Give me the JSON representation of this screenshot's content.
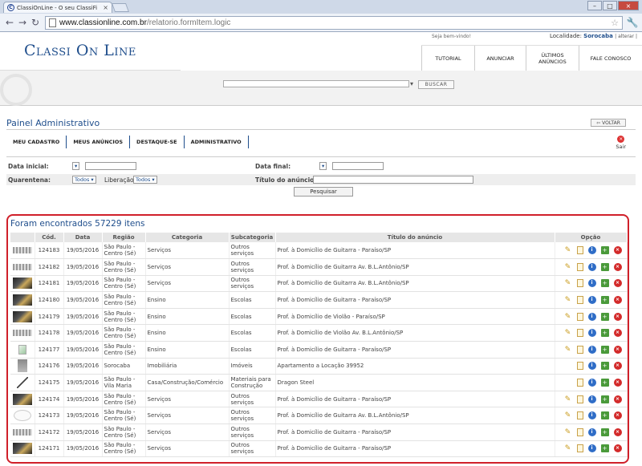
{
  "browser": {
    "tab_title": "ClassiOnLine - O seu ClassiFi",
    "url_host": "www.classionline.com.br",
    "url_path": "/relatorio.formItem.logic",
    "favicon_letter": "C",
    "icons": {
      "back": "back-arrow-icon",
      "forward": "forward-arrow-icon",
      "reload": "reload-icon",
      "star": "star-icon",
      "wrench": "wrench-icon"
    }
  },
  "header": {
    "logo": "Classi On Line",
    "welcome": "Seja bem-vindo!",
    "locality_label": "Localidade:",
    "locality_city": "Sorocaba",
    "locality_change": "| alterar |",
    "nav": [
      "TUTORIAL",
      "ANUNCIAR",
      "ÚLTIMOS ANÚNCIOS",
      "FALE CONOSCO"
    ],
    "search_button": "BUSCAR"
  },
  "panel": {
    "title": "Painel Administrativo",
    "back_button": "VOLTAR",
    "tabs": [
      "MEU CADASTRO",
      "MEUS ANÚNCIOS",
      "DESTAQUE-SE",
      "ADMINISTRATIVO"
    ],
    "logout": "Sair"
  },
  "filters": {
    "data_inicial_label": "Data inicial:",
    "data_final_label": "Data final:",
    "quarentena_label": "Quarentena:",
    "quarentena_value": "Todos",
    "liberacao_label": "Liberação",
    "liberacao_value": "Todos",
    "titulo_label": "Título do anúncio:",
    "date_dropdown": "▾",
    "search_button": "Pesquisar"
  },
  "results": {
    "title": "Foram encontrados 57229 itens",
    "columns": [
      "",
      "Cód.",
      "Data",
      "Região",
      "Categoria",
      "Subcategoria",
      "Título do anúncio",
      "Opção"
    ],
    "rows": [
      {
        "thumb": "light",
        "cod": "124183",
        "data": "19/05/2016",
        "regiao": "São Paulo - Centro (Sé)",
        "categoria": "Serviços",
        "sub": "Outros serviços",
        "titulo": "Prof. à Domicílio de Guitarra - Paraíso/SP",
        "edit": true
      },
      {
        "thumb": "light",
        "cod": "124182",
        "data": "19/05/2016",
        "regiao": "São Paulo - Centro (Sé)",
        "categoria": "Serviços",
        "sub": "Outros serviços",
        "titulo": "Prof. à Domicílio de Guitarra Av. B.L.Antônio/SP",
        "edit": true
      },
      {
        "thumb": "dark",
        "cod": "124181",
        "data": "19/05/2016",
        "regiao": "São Paulo - Centro (Sé)",
        "categoria": "Serviços",
        "sub": "Outros serviços",
        "titulo": "Prof. à Domicílio de Guitarra Av. B.L.Antônio/SP",
        "edit": true
      },
      {
        "thumb": "dark",
        "cod": "124180",
        "data": "19/05/2016",
        "regiao": "São Paulo - Centro (Sé)",
        "categoria": "Ensino",
        "sub": "Escolas",
        "titulo": "Prof. à Domicílio de Guitarra - Paraíso/SP",
        "edit": true
      },
      {
        "thumb": "dark",
        "cod": "124179",
        "data": "19/05/2016",
        "regiao": "São Paulo - Centro (Sé)",
        "categoria": "Ensino",
        "sub": "Escolas",
        "titulo": "Prof. à Domicílio de Violão - Paraíso/SP",
        "edit": true
      },
      {
        "thumb": "light",
        "cod": "124178",
        "data": "19/05/2016",
        "regiao": "São Paulo - Centro (Sé)",
        "categoria": "Ensino",
        "sub": "Escolas",
        "titulo": "Prof. à Domicílio de Violão Av. B.L.Antônio/SP",
        "edit": true
      },
      {
        "thumb": "broken",
        "cod": "124177",
        "data": "19/05/2016",
        "regiao": "São Paulo - Centro (Sé)",
        "categoria": "Ensino",
        "sub": "Escolas",
        "titulo": "Prof. à Domicílio de Guitarra - Paraíso/SP",
        "edit": true
      },
      {
        "thumb": "grey",
        "cod": "124176",
        "data": "19/05/2016",
        "regiao": "Sorocaba",
        "categoria": "Imobiliária",
        "sub": "Imóveis",
        "titulo": "Apartamento a Locação 39952",
        "edit": false
      },
      {
        "thumb": "line",
        "cod": "124175",
        "data": "19/05/2016",
        "regiao": "São Paulo - Vila Maria",
        "categoria": "Casa/Construção/Comércio",
        "sub": "Materiais para Construção",
        "titulo": "Dragon Steel",
        "edit": false
      },
      {
        "thumb": "dark",
        "cod": "124174",
        "data": "19/05/2016",
        "regiao": "São Paulo - Centro (Sé)",
        "categoria": "Serviços",
        "sub": "Outros serviços",
        "titulo": "Prof. à Domicílio de Guitarra - Paraíso/SP",
        "edit": true
      },
      {
        "thumb": "white",
        "cod": "124173",
        "data": "19/05/2016",
        "regiao": "São Paulo - Centro (Sé)",
        "categoria": "Serviços",
        "sub": "Outros serviços",
        "titulo": "Prof. à Domicílio de Guitarra Av. B.L.Antônio/SP",
        "edit": true
      },
      {
        "thumb": "light",
        "cod": "124172",
        "data": "19/05/2016",
        "regiao": "São Paulo - Centro (Sé)",
        "categoria": "Serviços",
        "sub": "Outros serviços",
        "titulo": "Prof. à Domicílio de Guitarra - Paraíso/SP",
        "edit": true
      },
      {
        "thumb": "dark",
        "cod": "124171",
        "data": "19/05/2016",
        "regiao": "São Paulo - Centro (Sé)",
        "categoria": "Serviços",
        "sub": "Outros serviços",
        "titulo": "Prof. à Domicílio de Guitarra - Paraíso/SP",
        "edit": true
      }
    ]
  }
}
